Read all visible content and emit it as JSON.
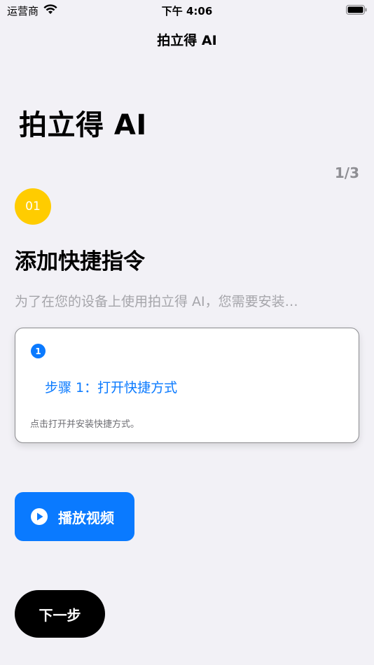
{
  "status_bar": {
    "carrier": "运营商",
    "time": "下午 4:06"
  },
  "nav": {
    "title": "拍立得 AI"
  },
  "header": {
    "large_title": "拍立得 AI",
    "page_indicator": "1/3"
  },
  "section": {
    "badge": "01",
    "title": "添加快捷指令",
    "description": "为了在您的设备上使用拍立得 AI，您需要安装…"
  },
  "step_card": {
    "number": "1",
    "link_label": "步骤 1：打开快捷方式",
    "hint": "点击打开并安装快捷方式。"
  },
  "actions": {
    "play_video_label": "播放视频",
    "next_label": "下一步"
  },
  "colors": {
    "background": "#f2f1f6",
    "accent_blue": "#0a7aff",
    "badge_yellow": "#ffcc00",
    "secondary_text": "#8e8e93"
  },
  "icons": {
    "wifi": "wifi-icon",
    "battery": "battery-icon",
    "play": "play-circle-icon"
  }
}
